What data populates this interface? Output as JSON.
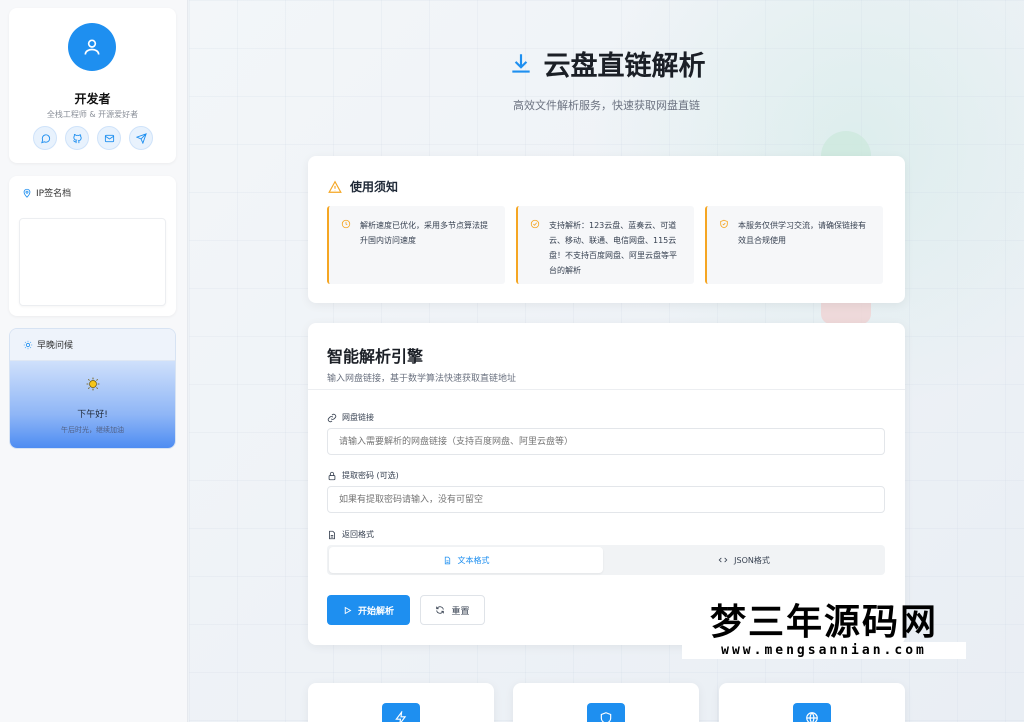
{
  "profile": {
    "name": "开发者",
    "subtitle": "全栈工程师 & 开源爱好者",
    "social_icons": [
      "chat-icon",
      "github-icon",
      "mail-icon",
      "send-icon"
    ]
  },
  "ip_card": {
    "title": "IP签名档"
  },
  "greeting": {
    "title": "早晚问候",
    "message": "下午好!",
    "sub": "午后时光，继续加油"
  },
  "hero": {
    "title": "云盘直链解析",
    "subtitle": "高效文件解析服务，快速获取网盘直链"
  },
  "notice": {
    "title": "使用须知",
    "items": [
      {
        "icon": "clock-icon",
        "text": "解析速度已优化，采用多节点算法提升国内访问速度"
      },
      {
        "icon": "check-circle-icon",
        "text": "支持解析：123云盘、蓝奏云、可道云、移动、联通、电信网盘、115云盘！不支持百度网盘、阿里云盘等平台的解析"
      },
      {
        "icon": "shield-check-icon",
        "text": "本服务仅供学习交流，请确保链接有效且合规使用"
      }
    ]
  },
  "engine": {
    "title": "智能解析引擎",
    "subtitle": "输入网盘链接，基于数学算法快速获取直链地址",
    "link_label": "网盘链接",
    "link_placeholder": "请输入需要解析的网盘链接（支持百度网盘、阿里云盘等）",
    "password_label": "提取密码 (可选)",
    "password_placeholder": "如果有提取密码请输入，没有可留空",
    "format_label": "返回格式",
    "format_text": "文本格式",
    "format_json": "JSON格式",
    "submit_label": "开始解析",
    "reset_label": "重置"
  },
  "watermark": {
    "main": "梦三年源码网",
    "url": "www.mengsannian.com"
  },
  "colors": {
    "accent": "#1e8ff0",
    "warning": "#f5a623"
  }
}
